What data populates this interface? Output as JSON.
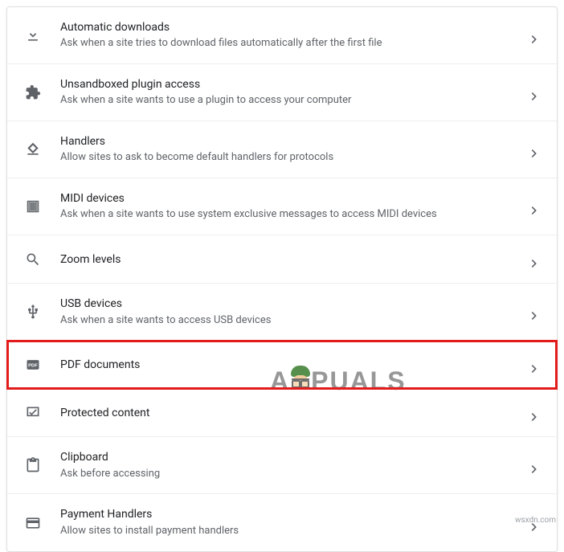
{
  "settings": [
    {
      "id": "automatic-downloads",
      "icon": "download-icon",
      "title": "Automatic downloads",
      "subtitle": "Ask when a site tries to download files automatically after the first file"
    },
    {
      "id": "unsandboxed-plugin",
      "icon": "plugin-icon",
      "title": "Unsandboxed plugin access",
      "subtitle": "Ask when a site wants to use a plugin to access your computer"
    },
    {
      "id": "handlers",
      "icon": "handlers-icon",
      "title": "Handlers",
      "subtitle": "Allow sites to ask to become default handlers for protocols"
    },
    {
      "id": "midi-devices",
      "icon": "midi-icon",
      "title": "MIDI devices",
      "subtitle": "Ask when a site wants to use system exclusive messages to access MIDI devices"
    },
    {
      "id": "zoom-levels",
      "icon": "zoom-icon",
      "title": "Zoom levels",
      "subtitle": ""
    },
    {
      "id": "usb-devices",
      "icon": "usb-icon",
      "title": "USB devices",
      "subtitle": "Ask when a site wants to access USB devices"
    },
    {
      "id": "pdf-documents",
      "icon": "pdf-icon",
      "title": "PDF documents",
      "subtitle": "",
      "highlighted": true
    },
    {
      "id": "protected-content",
      "icon": "protected-icon",
      "title": "Protected content",
      "subtitle": ""
    },
    {
      "id": "clipboard",
      "icon": "clipboard-icon",
      "title": "Clipboard",
      "subtitle": "Ask before accessing"
    },
    {
      "id": "payment-handlers",
      "icon": "payment-icon",
      "title": "Payment Handlers",
      "subtitle": "Allow sites to install payment handlers"
    }
  ],
  "watermark_logo": "APPUALS",
  "watermark_url": "wsxdn.com"
}
